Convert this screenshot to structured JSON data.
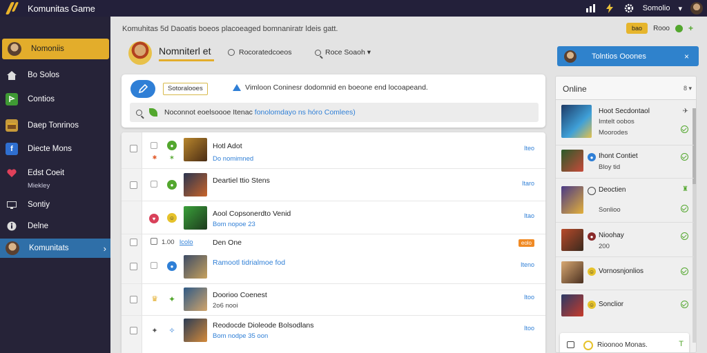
{
  "app": {
    "title": "Komunitas Game"
  },
  "topbar": {
    "user_name": "Somolio",
    "user_caret": "▾"
  },
  "sidebar": {
    "items": [
      {
        "label": "Nomoniis",
        "sub": ""
      },
      {
        "label": "Bo Solos",
        "sub": ""
      },
      {
        "label": "Contios",
        "sub": ""
      },
      {
        "label": "Daep Tonrinos",
        "sub": ""
      },
      {
        "label": "Diecte Mons",
        "sub": ""
      },
      {
        "label": "Edst Coeit",
        "sub": "Miekley"
      },
      {
        "label": "Sontiy",
        "sub": ""
      },
      {
        "label": "Delne",
        "sub": ""
      },
      {
        "label": "Komunitats",
        "sub": ""
      }
    ],
    "active_caret": "›"
  },
  "main": {
    "breadcrumb": "Komuhitas 5d Daoatis boeos placoeaged bomnaniratr ldeis gatt.",
    "top_pill": "bao",
    "top_text": "Rooo",
    "page_title": "Nomniterl et",
    "tabs": [
      {
        "label": "Rocoratedcoeos"
      },
      {
        "label": "Roce Soaoh ▾"
      }
    ],
    "toolbar": {
      "sub_button": "Sotoralooes",
      "notice": "Vimloon Coninesr dodomnid en boeone end locoapeand."
    },
    "search": {
      "prefix": "Noconnot eoelsoooe Itenac",
      "link": "fonolomdayo ns hóro Comlees)"
    },
    "rows": [
      {
        "name": "Hotl Adot",
        "sub": "Do nomimned",
        "action": "Iteo"
      },
      {
        "name": "Deartiel ttio Stens",
        "sub": "",
        "action": "Itaro"
      },
      {
        "name": "Aool Copsonerdto Venid",
        "sub": "Bom nopoe 23",
        "action": "Itao"
      },
      {
        "group": "1.00",
        "group_link": "lcolo",
        "name": "Den One",
        "badge": "eolo"
      },
      {
        "name": "Ramootl tidrialmoe fod",
        "sub": "",
        "action": "Iteno"
      },
      {
        "name": "Doorioo Coenest",
        "sub": "2o6 nooi",
        "action": "Itoo"
      },
      {
        "name": "Reodocde Dioleode Bolsodlans",
        "sub": "Bom nodpe 35 oon",
        "action": "Itoo"
      }
    ]
  },
  "right_panel": {
    "banner": "Tolntios Ooones",
    "banner_close": "×",
    "online_title": "Online",
    "online_ctrl": "8 ▾",
    "people": [
      {
        "name": "Hoot Secdontaol",
        "sub": "Imtelt oobos",
        "sub2": "Moorodes"
      },
      {
        "name": "Ihont Contiet",
        "sub": "Bloy tid"
      },
      {
        "name": "Deoctien",
        "sub": "Sonlioo"
      },
      {
        "name": "Nioohay",
        "sub": "200"
      },
      {
        "name": "Vornosnjonlios",
        "sub": ""
      },
      {
        "name": "Sonclior",
        "sub": ""
      }
    ],
    "compose": "Rioonoo Monas."
  },
  "colors": {
    "accent_gold": "#e3ad2b",
    "accent_blue": "#2f82cc",
    "sidebar_bg": "#262338",
    "online_green": "#53a72e"
  }
}
